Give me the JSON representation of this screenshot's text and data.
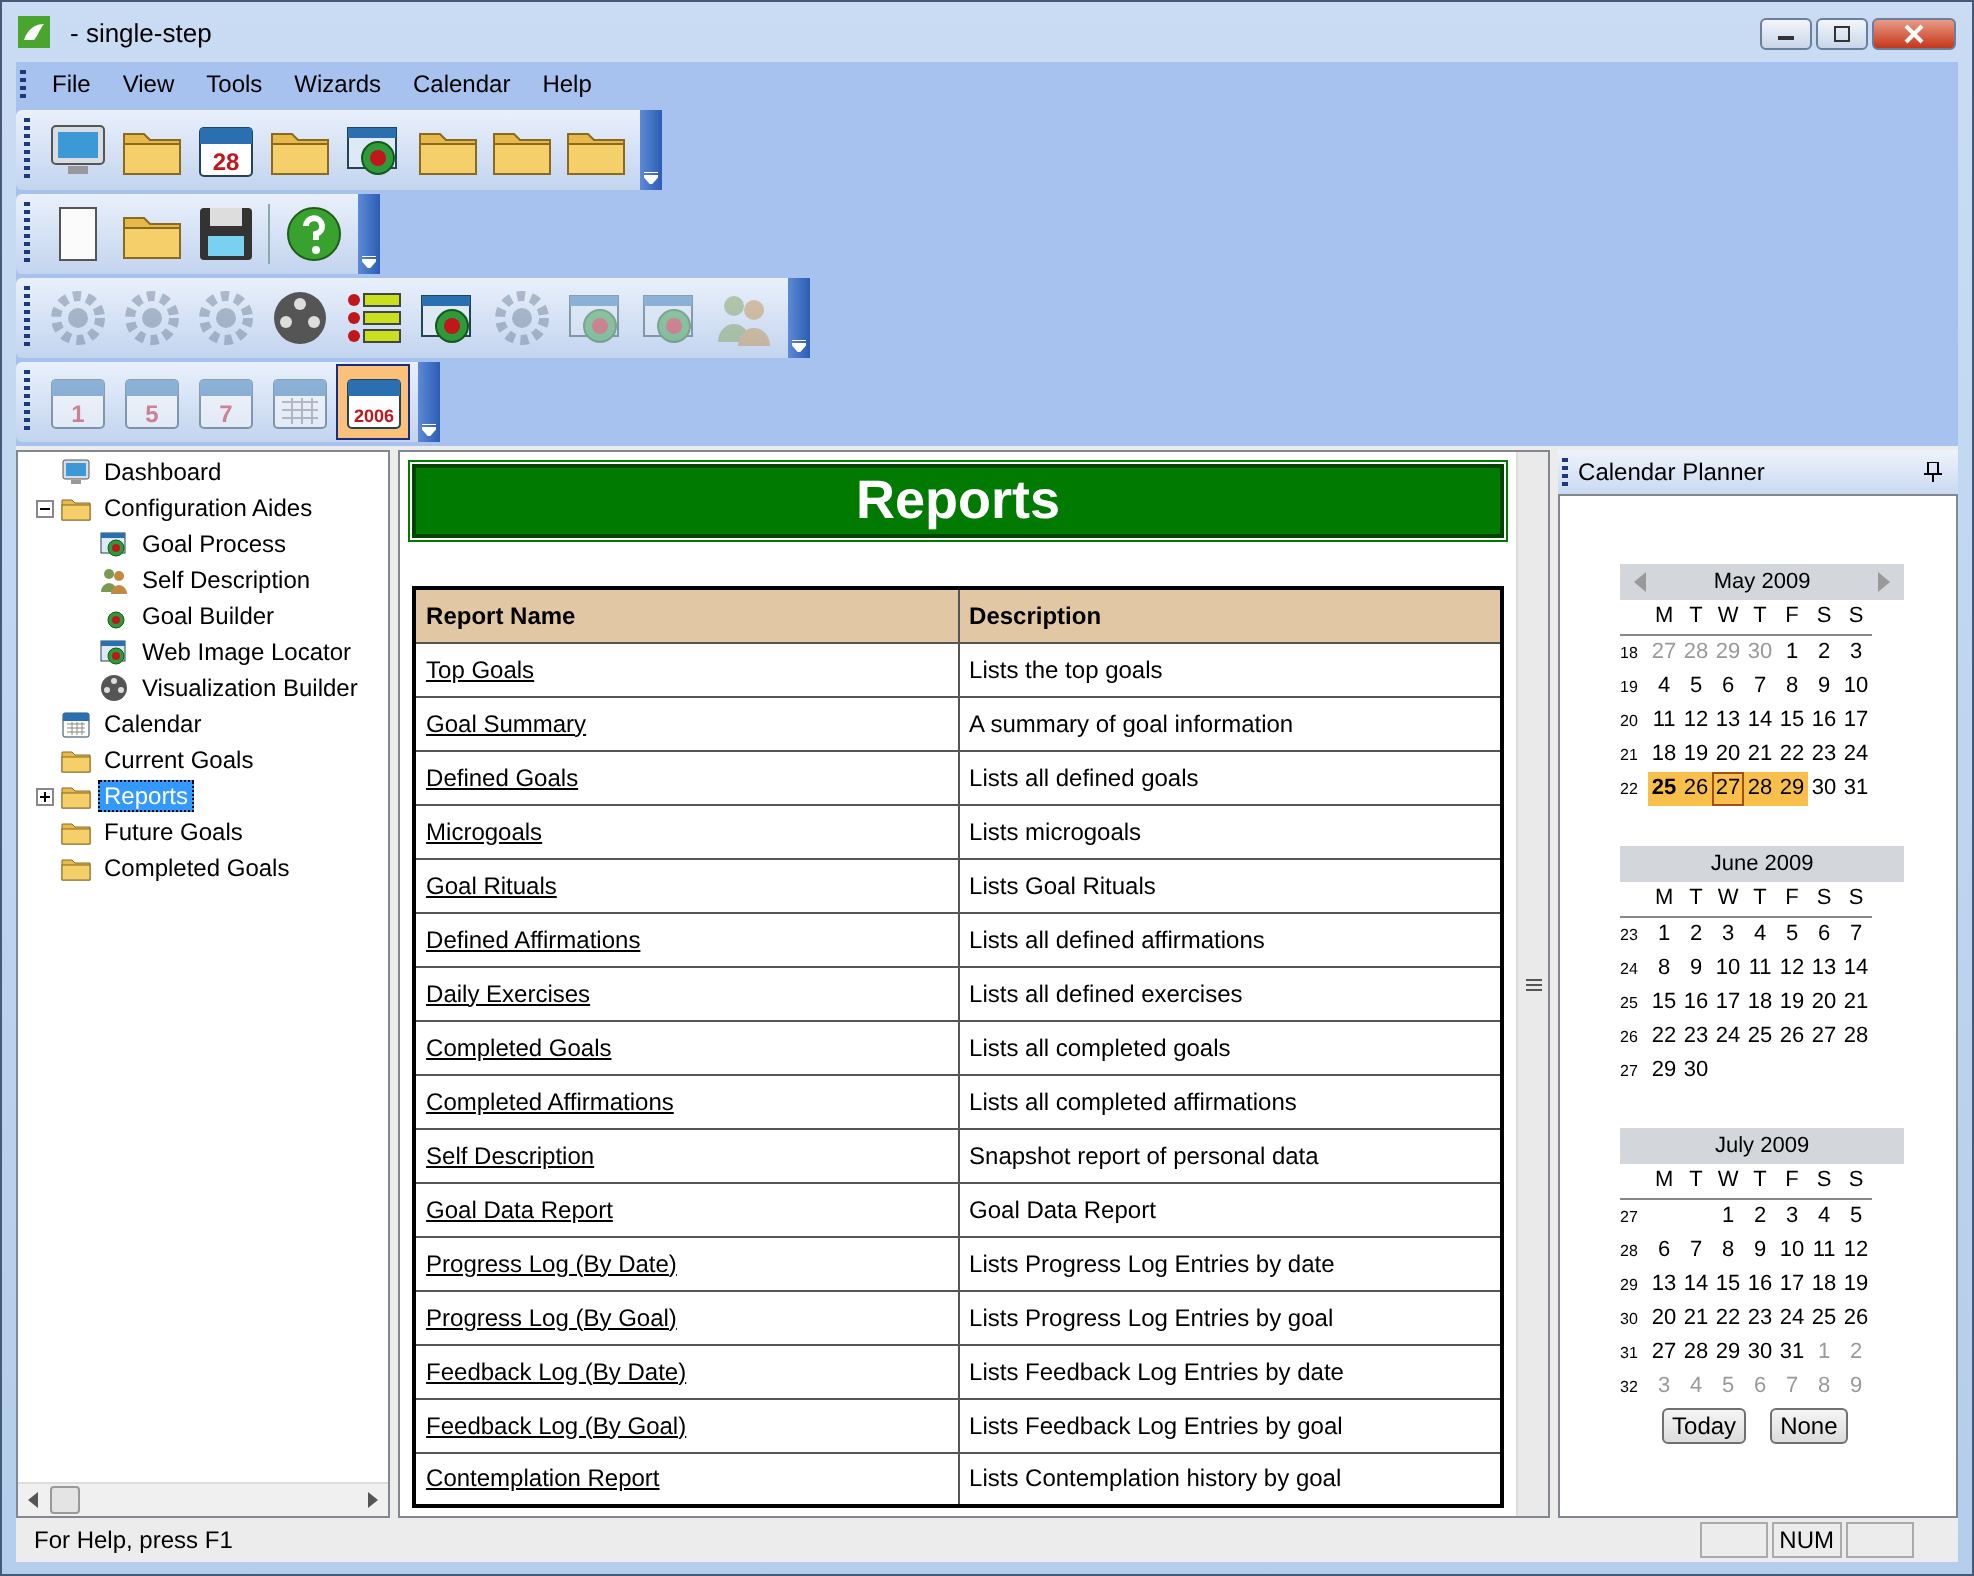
{
  "window": {
    "title": "- single-step"
  },
  "menu": [
    "File",
    "View",
    "Tools",
    "Wizards",
    "Calendar",
    "Help"
  ],
  "toolbars": [
    [
      {
        "kind": "monitor",
        "disabled": false,
        "pressed": false
      },
      {
        "kind": "folder",
        "disabled": false,
        "pressed": false
      },
      {
        "kind": "calendar",
        "text": "28",
        "disabled": false,
        "pressed": false
      },
      {
        "kind": "folder",
        "disabled": false,
        "pressed": false
      },
      {
        "kind": "window",
        "disabled": false,
        "pressed": false
      },
      {
        "kind": "folder",
        "disabled": false,
        "pressed": false
      },
      {
        "kind": "folder",
        "disabled": false,
        "pressed": false
      },
      {
        "kind": "folder",
        "disabled": false,
        "pressed": false
      }
    ],
    [
      {
        "kind": "page",
        "disabled": false,
        "pressed": false
      },
      {
        "kind": "folder",
        "disabled": false,
        "pressed": false
      },
      {
        "kind": "save",
        "disabled": false,
        "pressed": false
      },
      {
        "kind": "separator"
      },
      {
        "kind": "help",
        "disabled": false,
        "pressed": false
      }
    ],
    [
      {
        "kind": "gear",
        "disabled": true,
        "pressed": false
      },
      {
        "kind": "gear",
        "disabled": true,
        "pressed": false
      },
      {
        "kind": "gear",
        "disabled": true,
        "pressed": false
      },
      {
        "kind": "film",
        "disabled": false,
        "pressed": false
      },
      {
        "kind": "list",
        "disabled": false,
        "pressed": false
      },
      {
        "kind": "window",
        "disabled": false,
        "pressed": false
      },
      {
        "kind": "gear",
        "disabled": true,
        "pressed": false
      },
      {
        "kind": "window",
        "disabled": true,
        "pressed": false
      },
      {
        "kind": "window",
        "disabled": true,
        "pressed": false
      },
      {
        "kind": "people",
        "disabled": true,
        "pressed": false
      }
    ],
    [
      {
        "kind": "calendar",
        "text": "1",
        "disabled": true,
        "pressed": false
      },
      {
        "kind": "calendar",
        "text": "5",
        "disabled": true,
        "pressed": false
      },
      {
        "kind": "calendar",
        "text": "7",
        "disabled": true,
        "pressed": false
      },
      {
        "kind": "calendar",
        "disabled": true,
        "pressed": false
      },
      {
        "kind": "calendar",
        "text": "2006",
        "disabled": false,
        "pressed": true
      }
    ]
  ],
  "tree": [
    {
      "label": "Dashboard",
      "kind": "monitor",
      "selected": false
    },
    {
      "label": "Configuration Aides",
      "kind": "folder",
      "selected": false,
      "expanded": true,
      "children": [
        {
          "label": "Goal Process",
          "kind": "window",
          "selected": false
        },
        {
          "label": "Self Description",
          "kind": "people",
          "selected": false
        },
        {
          "label": "Goal Builder",
          "kind": "target",
          "selected": false
        },
        {
          "label": "Web Image Locator",
          "kind": "window",
          "selected": false
        },
        {
          "label": "Visualization Builder",
          "kind": "film",
          "selected": false
        }
      ]
    },
    {
      "label": "Calendar",
      "kind": "calendar",
      "selected": false
    },
    {
      "label": "Current Goals",
      "kind": "folder",
      "selected": false
    },
    {
      "label": "Reports",
      "kind": "folder",
      "selected": true,
      "expanded": false
    },
    {
      "label": "Future Goals",
      "kind": "folder",
      "selected": false
    },
    {
      "label": "Completed Goals",
      "kind": "folder",
      "selected": false
    }
  ],
  "report": {
    "title": "Reports",
    "columns": [
      "Report Name",
      "Description"
    ],
    "rows": [
      [
        "Top Goals",
        "Lists the top goals"
      ],
      [
        "Goal Summary",
        "A summary of goal information"
      ],
      [
        "Defined Goals",
        "Lists all defined goals"
      ],
      [
        "Microgoals",
        "Lists microgoals"
      ],
      [
        "Goal Rituals",
        "Lists Goal Rituals"
      ],
      [
        "Defined Affirmations",
        "Lists all defined affirmations"
      ],
      [
        "Daily Exercises",
        "Lists all defined exercises"
      ],
      [
        "Completed Goals",
        "Lists all completed goals"
      ],
      [
        "Completed Affirmations",
        "Lists all completed affirmations"
      ],
      [
        "Self Description",
        "Snapshot report of personal data"
      ],
      [
        "Goal Data Report",
        "Goal Data Report"
      ],
      [
        "Progress Log (By Date)",
        "Lists Progress Log Entries by date"
      ],
      [
        "Progress Log (By Goal)",
        "Lists Progress Log Entries by goal"
      ],
      [
        "Feedback Log (By Date)",
        "Lists Feedback Log Entries by date"
      ],
      [
        "Feedback Log (By Goal)",
        "Lists Feedback Log Entries by goal"
      ],
      [
        "Contemplation Report",
        "Lists Contemplation history by goal"
      ]
    ]
  },
  "calendar": {
    "title": "Calendar Planner",
    "months": [
      {
        "title": "May 2009",
        "arrows": true,
        "weekdays": [
          "M",
          "T",
          "W",
          "T",
          "F",
          "S",
          "S"
        ],
        "weeks": [
          {
            "week": "18",
            "days": [
              {
                "n": "27",
                "dim": true,
                "selected": false
              },
              {
                "n": "28",
                "dim": true,
                "selected": false
              },
              {
                "n": "29",
                "dim": true,
                "selected": false
              },
              {
                "n": "30",
                "dim": true,
                "selected": false
              },
              {
                "n": "1",
                "dim": false,
                "selected": false
              },
              {
                "n": "2",
                "dim": false,
                "selected": false
              },
              {
                "n": "3",
                "dim": false,
                "selected": false
              }
            ]
          },
          {
            "week": "19",
            "days": [
              {
                "n": "4",
                "dim": false,
                "selected": false
              },
              {
                "n": "5",
                "dim": false,
                "selected": false
              },
              {
                "n": "6",
                "dim": false,
                "selected": false
              },
              {
                "n": "7",
                "dim": false,
                "selected": false
              },
              {
                "n": "8",
                "dim": false,
                "selected": false
              },
              {
                "n": "9",
                "dim": false,
                "selected": false
              },
              {
                "n": "10",
                "dim": false,
                "selected": false
              }
            ]
          },
          {
            "week": "20",
            "days": [
              {
                "n": "11",
                "dim": false,
                "selected": false
              },
              {
                "n": "12",
                "dim": false,
                "selected": false
              },
              {
                "n": "13",
                "dim": false,
                "selected": false
              },
              {
                "n": "14",
                "dim": false,
                "selected": false
              },
              {
                "n": "15",
                "dim": false,
                "selected": false
              },
              {
                "n": "16",
                "dim": false,
                "selected": false
              },
              {
                "n": "17",
                "dim": false,
                "selected": false
              }
            ]
          },
          {
            "week": "21",
            "days": [
              {
                "n": "18",
                "dim": false,
                "selected": false
              },
              {
                "n": "19",
                "dim": false,
                "selected": false
              },
              {
                "n": "20",
                "dim": false,
                "selected": false
              },
              {
                "n": "21",
                "dim": false,
                "selected": false
              },
              {
                "n": "22",
                "dim": false,
                "selected": false
              },
              {
                "n": "23",
                "dim": false,
                "selected": false
              },
              {
                "n": "24",
                "dim": false,
                "selected": false
              }
            ]
          },
          {
            "week": "22",
            "days": [
              {
                "n": "25",
                "dim": false,
                "selected": true,
                "today": true
              },
              {
                "n": "26",
                "dim": false,
                "selected": true
              },
              {
                "n": "27",
                "dim": false,
                "selected": true,
                "focused": true
              },
              {
                "n": "28",
                "dim": false,
                "selected": true
              },
              {
                "n": "29",
                "dim": false,
                "selected": true
              },
              {
                "n": "30",
                "dim": false,
                "selected": false
              },
              {
                "n": "31",
                "dim": false,
                "selected": false
              }
            ]
          }
        ]
      },
      {
        "title": "June 2009",
        "arrows": false,
        "weekdays": [
          "M",
          "T",
          "W",
          "T",
          "F",
          "S",
          "S"
        ],
        "weeks": [
          {
            "week": "23",
            "days": [
              {
                "n": "1",
                "dim": false,
                "selected": false
              },
              {
                "n": "2",
                "dim": false,
                "selected": false
              },
              {
                "n": "3",
                "dim": false,
                "selected": false
              },
              {
                "n": "4",
                "dim": false,
                "selected": false
              },
              {
                "n": "5",
                "dim": false,
                "selected": false
              },
              {
                "n": "6",
                "dim": false,
                "selected": false
              },
              {
                "n": "7",
                "dim": false,
                "selected": false
              }
            ]
          },
          {
            "week": "24",
            "days": [
              {
                "n": "8",
                "dim": false,
                "selected": false
              },
              {
                "n": "9",
                "dim": false,
                "selected": false
              },
              {
                "n": "10",
                "dim": false,
                "selected": false
              },
              {
                "n": "11",
                "dim": false,
                "selected": false
              },
              {
                "n": "12",
                "dim": false,
                "selected": false
              },
              {
                "n": "13",
                "dim": false,
                "selected": false
              },
              {
                "n": "14",
                "dim": false,
                "selected": false
              }
            ]
          },
          {
            "week": "25",
            "days": [
              {
                "n": "15",
                "dim": false,
                "selected": false
              },
              {
                "n": "16",
                "dim": false,
                "selected": false
              },
              {
                "n": "17",
                "dim": false,
                "selected": false
              },
              {
                "n": "18",
                "dim": false,
                "selected": false
              },
              {
                "n": "19",
                "dim": false,
                "selected": false
              },
              {
                "n": "20",
                "dim": false,
                "selected": false
              },
              {
                "n": "21",
                "dim": false,
                "selected": false
              }
            ]
          },
          {
            "week": "26",
            "days": [
              {
                "n": "22",
                "dim": false,
                "selected": false
              },
              {
                "n": "23",
                "dim": false,
                "selected": false
              },
              {
                "n": "24",
                "dim": false,
                "selected": false
              },
              {
                "n": "25",
                "dim": false,
                "selected": false
              },
              {
                "n": "26",
                "dim": false,
                "selected": false
              },
              {
                "n": "27",
                "dim": false,
                "selected": false
              },
              {
                "n": "28",
                "dim": false,
                "selected": false
              }
            ]
          },
          {
            "week": "27",
            "align_right": false,
            "days": [
              {
                "n": "29",
                "dim": false,
                "selected": false
              },
              {
                "n": "30",
                "dim": false,
                "selected": false
              }
            ]
          }
        ]
      },
      {
        "title": "July 2009",
        "arrows": false,
        "weekdays": [
          "M",
          "T",
          "W",
          "T",
          "F",
          "S",
          "S"
        ],
        "weeks": [
          {
            "week": "27",
            "align_right": true,
            "days": [
              {
                "n": "1",
                "dim": false,
                "selected": false
              },
              {
                "n": "2",
                "dim": false,
                "selected": false
              },
              {
                "n": "3",
                "dim": false,
                "selected": false
              },
              {
                "n": "4",
                "dim": false,
                "selected": false
              },
              {
                "n": "5",
                "dim": false,
                "selected": false
              }
            ]
          },
          {
            "week": "28",
            "days": [
              {
                "n": "6",
                "dim": false,
                "selected": false
              },
              {
                "n": "7",
                "dim": false,
                "selected": false
              },
              {
                "n": "8",
                "dim": false,
                "selected": false
              },
              {
                "n": "9",
                "dim": false,
                "selected": false
              },
              {
                "n": "10",
                "dim": false,
                "selected": false
              },
              {
                "n": "11",
                "dim": false,
                "selected": false
              },
              {
                "n": "12",
                "dim": false,
                "selected": false
              }
            ]
          },
          {
            "week": "29",
            "days": [
              {
                "n": "13",
                "dim": false,
                "selected": false
              },
              {
                "n": "14",
                "dim": false,
                "selected": false
              },
              {
                "n": "15",
                "dim": false,
                "selected": false
              },
              {
                "n": "16",
                "dim": false,
                "selected": false
              },
              {
                "n": "17",
                "dim": false,
                "selected": false
              },
              {
                "n": "18",
                "dim": false,
                "selected": false
              },
              {
                "n": "19",
                "dim": false,
                "selected": false
              }
            ]
          },
          {
            "week": "30",
            "days": [
              {
                "n": "20",
                "dim": false,
                "selected": false
              },
              {
                "n": "21",
                "dim": false,
                "selected": false
              },
              {
                "n": "22",
                "dim": false,
                "selected": false
              },
              {
                "n": "23",
                "dim": false,
                "selected": false
              },
              {
                "n": "24",
                "dim": false,
                "selected": false
              },
              {
                "n": "25",
                "dim": false,
                "selected": false
              },
              {
                "n": "26",
                "dim": false,
                "selected": false
              }
            ]
          },
          {
            "week": "31",
            "days": [
              {
                "n": "27",
                "dim": false,
                "selected": false
              },
              {
                "n": "28",
                "dim": false,
                "selected": false
              },
              {
                "n": "29",
                "dim": false,
                "selected": false
              },
              {
                "n": "30",
                "dim": false,
                "selected": false
              },
              {
                "n": "31",
                "dim": false,
                "selected": false
              },
              {
                "n": "1",
                "dim": true,
                "selected": false
              },
              {
                "n": "2",
                "dim": true,
                "selected": false
              }
            ]
          },
          {
            "week": "32",
            "days": [
              {
                "n": "3",
                "dim": true,
                "selected": false
              },
              {
                "n": "4",
                "dim": true,
                "selected": false
              },
              {
                "n": "5",
                "dim": true,
                "selected": false
              },
              {
                "n": "6",
                "dim": true,
                "selected": false
              },
              {
                "n": "7",
                "dim": true,
                "selected": false
              },
              {
                "n": "8",
                "dim": true,
                "selected": false
              },
              {
                "n": "9",
                "dim": true,
                "selected": false
              }
            ]
          }
        ]
      }
    ],
    "buttons": [
      "Today",
      "None"
    ]
  },
  "status_bar": {
    "text": "For Help, press F1",
    "panels": [
      "NUM"
    ]
  }
}
